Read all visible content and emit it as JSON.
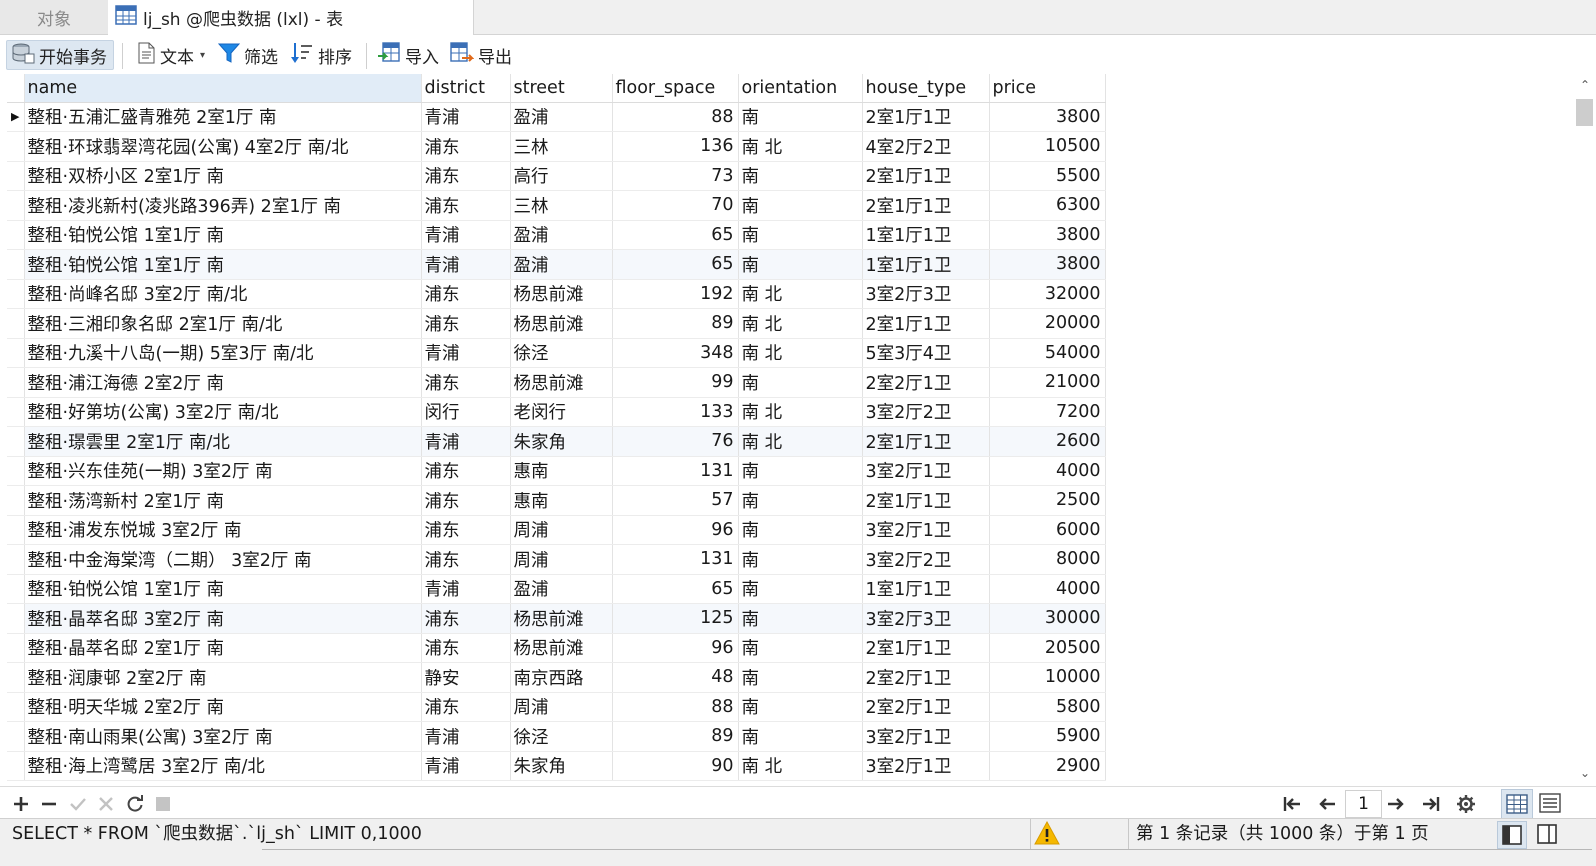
{
  "tabs": {
    "objects_label": "对象",
    "table_tab_label": "lj_sh @爬虫数据 (lxl) - 表"
  },
  "toolbar": {
    "begin_transaction": "开始事务",
    "text": "文本",
    "filter": "筛选",
    "sort": "排序",
    "import": "导入",
    "export": "导出"
  },
  "table": {
    "columns": [
      "name",
      "district",
      "street",
      "floor_space",
      "orientation",
      "house_type",
      "price"
    ],
    "rows": [
      [
        "整租·五浦汇盛青雅苑 2室1厅 南",
        "青浦",
        "盈浦",
        "88",
        "南",
        "2室1厅1卫",
        "3800"
      ],
      [
        "整租·环球翡翠湾花园(公寓) 4室2厅 南/北",
        "浦东",
        "三林",
        "136",
        "南 北",
        "4室2厅2卫",
        "10500"
      ],
      [
        "整租·双桥小区 2室1厅 南",
        "浦东",
        "高行",
        "73",
        "南",
        "2室1厅1卫",
        "5500"
      ],
      [
        "整租·凌兆新村(凌兆路396弄) 2室1厅 南",
        "浦东",
        "三林",
        "70",
        "南",
        "2室1厅1卫",
        "6300"
      ],
      [
        "整租·铂悦公馆 1室1厅 南",
        "青浦",
        "盈浦",
        "65",
        "南",
        "1室1厅1卫",
        "3800"
      ],
      [
        "整租·铂悦公馆 1室1厅 南",
        "青浦",
        "盈浦",
        "65",
        "南",
        "1室1厅1卫",
        "3800"
      ],
      [
        "整租·尚峰名邸 3室2厅 南/北",
        "浦东",
        "杨思前滩",
        "192",
        "南 北",
        "3室2厅3卫",
        "32000"
      ],
      [
        "整租·三湘印象名邸 2室1厅 南/北",
        "浦东",
        "杨思前滩",
        "89",
        "南 北",
        "2室1厅1卫",
        "20000"
      ],
      [
        "整租·九溪十八岛(一期) 5室3厅 南/北",
        "青浦",
        "徐泾",
        "348",
        "南 北",
        "5室3厅4卫",
        "54000"
      ],
      [
        "整租·浦江海德 2室2厅 南",
        "浦东",
        "杨思前滩",
        "99",
        "南",
        "2室2厅1卫",
        "21000"
      ],
      [
        "整租·好第坊(公寓) 3室2厅 南/北",
        "闵行",
        "老闵行",
        "133",
        "南 北",
        "3室2厅2卫",
        "7200"
      ],
      [
        "整租·璟雲里 2室1厅 南/北",
        "青浦",
        "朱家角",
        "76",
        "南 北",
        "2室1厅1卫",
        "2600"
      ],
      [
        "整租·兴东佳苑(一期) 3室2厅 南",
        "浦东",
        "惠南",
        "131",
        "南",
        "3室2厅1卫",
        "4000"
      ],
      [
        "整租·荡湾新村 2室1厅 南",
        "浦东",
        "惠南",
        "57",
        "南",
        "2室1厅1卫",
        "2500"
      ],
      [
        "整租·浦发东悦城 3室2厅 南",
        "浦东",
        "周浦",
        "96",
        "南",
        "3室2厅1卫",
        "6000"
      ],
      [
        "整租·中金海棠湾（二期） 3室2厅 南",
        "浦东",
        "周浦",
        "131",
        "南",
        "3室2厅2卫",
        "8000"
      ],
      [
        "整租·铂悦公馆 1室1厅 南",
        "青浦",
        "盈浦",
        "65",
        "南",
        "1室1厅1卫",
        "4000"
      ],
      [
        "整租·晶萃名邸 3室2厅 南",
        "浦东",
        "杨思前滩",
        "125",
        "南",
        "3室2厅3卫",
        "30000"
      ],
      [
        "整租·晶萃名邸 2室1厅 南",
        "浦东",
        "杨思前滩",
        "96",
        "南",
        "2室1厅1卫",
        "20500"
      ],
      [
        "整租·润康邨 2室2厅 南",
        "静安",
        "南京西路",
        "48",
        "南",
        "2室2厅1卫",
        "10000"
      ],
      [
        "整租·明天华城 2室2厅 南",
        "浦东",
        "周浦",
        "88",
        "南",
        "2室2厅1卫",
        "5800"
      ],
      [
        "整租·南山雨果(公寓) 3室2厅 南",
        "青浦",
        "徐泾",
        "89",
        "南",
        "3室2厅1卫",
        "5900"
      ],
      [
        "整租·海上湾鹭居 3室2厅 南/北",
        "青浦",
        "朱家角",
        "90",
        "南 北",
        "3室2厅1卫",
        "2900"
      ]
    ]
  },
  "navigation": {
    "current_page": "1"
  },
  "status": {
    "sql": "SELECT * FROM `爬虫数据`.`lj_sh` LIMIT 0,1000",
    "record_info": "第 1 条记录（共 1000 条）于第 1 页"
  },
  "icons": {
    "table_tab": "table-icon",
    "begin_transaction": "database-icon",
    "text": "document-icon",
    "filter": "funnel-icon",
    "sort": "sort-icon",
    "import": "import-icon",
    "export": "export-icon",
    "warning": "warning-icon"
  },
  "colors": {
    "selected_header": "#e1ecf7",
    "alt_row": "#f5f8fc",
    "filter_icon": "#1e88e5",
    "warning": "#f5b800"
  }
}
